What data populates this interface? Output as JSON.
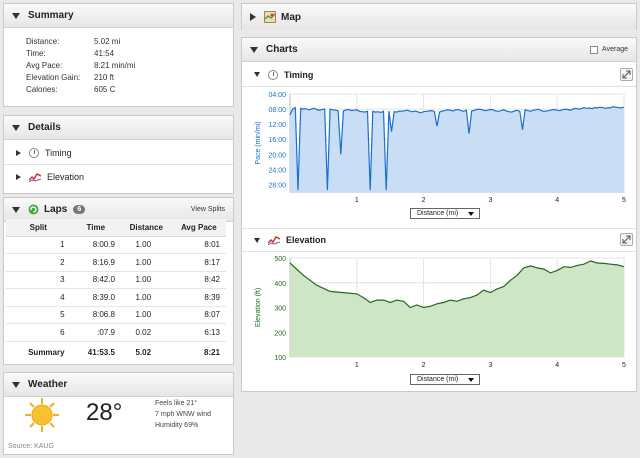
{
  "summary": {
    "title": "Summary",
    "rows": [
      {
        "label": "Distance:",
        "value": "5.02 mi"
      },
      {
        "label": "Time:",
        "value": "41:54"
      },
      {
        "label": "Avg Pace:",
        "value": "8:21 min/mi"
      },
      {
        "label": "Elevation Gain:",
        "value": "210 ft"
      },
      {
        "label": "Calories:",
        "value": "605 C"
      }
    ]
  },
  "details": {
    "title": "Details",
    "items": [
      {
        "label": "Timing",
        "icon": "clock-icon"
      },
      {
        "label": "Elevation",
        "icon": "elevation-icon"
      }
    ]
  },
  "laps": {
    "title": "Laps",
    "count": "6",
    "view_splits": "View Splits",
    "columns": [
      "Split",
      "Time",
      "Distance",
      "Avg Pace"
    ],
    "rows": [
      [
        "1",
        "8:00.9",
        "1.00",
        "8:01"
      ],
      [
        "2",
        "8:16.9",
        "1.00",
        "8:17"
      ],
      [
        "3",
        "8:42.0",
        "1.00",
        "8:42"
      ],
      [
        "4",
        "8:39.0",
        "1.00",
        "8:39"
      ],
      [
        "5",
        "8:06.8",
        "1.00",
        "8:07"
      ],
      [
        "6",
        ":07.9",
        "0.02",
        "6:13"
      ]
    ],
    "summary": [
      "Summary",
      "41:53.5",
      "5.02",
      "8:21"
    ]
  },
  "weather": {
    "title": "Weather",
    "temp": "28°",
    "feels_like": "Feels like 21°",
    "wind": "7 mph WNW wind",
    "humidity": "Humidity 69%",
    "source": "Source: KAUG",
    "icon": "sun-icon"
  },
  "map": {
    "title": "Map",
    "icon": "map-icon"
  },
  "charts": {
    "title": "Charts",
    "average_label": "Average",
    "average_checked": false,
    "timing": {
      "title": "Timing",
      "axis_select": "Distance (mi)"
    },
    "elevation": {
      "title": "Elevation",
      "axis_select": "Distance (mi)"
    }
  },
  "colors": {
    "pace": "#1a6fd0",
    "pace_fill": "#c9def5",
    "elev": "#1e6b1e",
    "elev_fill": "#cfe6c6"
  },
  "chart_data": [
    {
      "type": "area",
      "title": "",
      "xlabel": "Distance (mi)",
      "ylabel": "Pace (min/mi)",
      "xlim": [
        0,
        5
      ],
      "ylim": [
        4,
        30
      ],
      "y_inverted": true,
      "x_ticks": [
        "1",
        "2",
        "3",
        "4",
        "5"
      ],
      "y_ticks": [
        "04:00",
        "08:00",
        "12:00",
        "16:00",
        "20:00",
        "24:00",
        "28:00"
      ],
      "grid": true,
      "series": [
        {
          "x": [
            0.0,
            0.04,
            0.08,
            0.12,
            0.16,
            0.2,
            0.24,
            0.28,
            0.32,
            0.36,
            0.4,
            0.44,
            0.48,
            0.52,
            0.56,
            0.6,
            0.64,
            0.68,
            0.72,
            0.76,
            0.8,
            0.84,
            0.88,
            0.92,
            0.96,
            1.0,
            1.04,
            1.08,
            1.12,
            1.16,
            1.2,
            1.24,
            1.28,
            1.32,
            1.36,
            1.4,
            1.44,
            1.48,
            1.52,
            1.56,
            1.6,
            1.64,
            1.68,
            1.72,
            1.76,
            1.8,
            1.84,
            1.88,
            1.92,
            1.96,
            2.0,
            2.04,
            2.08,
            2.12,
            2.16,
            2.2,
            2.24,
            2.28,
            2.32,
            2.36,
            2.4,
            2.44,
            2.48,
            2.52,
            2.56,
            2.6,
            2.64,
            2.68,
            2.72,
            2.76,
            2.8,
            2.84,
            2.88,
            2.92,
            2.96,
            3.0,
            3.04,
            3.08,
            3.12,
            3.16,
            3.2,
            3.24,
            3.28,
            3.32,
            3.36,
            3.4,
            3.44,
            3.48,
            3.52,
            3.56,
            3.6,
            3.64,
            3.68,
            3.72,
            3.76,
            3.8,
            3.84,
            3.88,
            3.92,
            3.96,
            4.0,
            4.04,
            4.08,
            4.12,
            4.16,
            4.2,
            4.24,
            4.28,
            4.32,
            4.36,
            4.4,
            4.44,
            4.48,
            4.52,
            4.56,
            4.6,
            4.64,
            4.68,
            4.72,
            4.76,
            4.8,
            4.84,
            4.88,
            4.92,
            4.96,
            5.0
          ],
          "values": [
            9.5,
            8.0,
            7.6,
            29.5,
            7.8,
            8.0,
            7.9,
            8.2,
            8.0,
            7.8,
            8.1,
            8.3,
            8.1,
            8.0,
            29.5,
            8.0,
            8.2,
            8.3,
            8.4,
            20.0,
            8.5,
            8.2,
            8.1,
            8.4,
            8.3,
            8.2,
            8.6,
            8.7,
            8.8,
            8.6,
            29.5,
            8.6,
            8.8,
            8.7,
            8.9,
            8.6,
            29.5,
            8.5,
            14.0,
            8.7,
            8.8,
            8.5,
            8.6,
            8.4,
            8.3,
            8.6,
            8.7,
            8.5,
            8.8,
            9.0,
            8.7,
            8.6,
            8.5,
            8.4,
            8.6,
            12.5,
            8.8,
            8.5,
            8.4,
            8.2,
            8.3,
            8.5,
            8.2,
            8.1,
            8.4,
            8.6,
            8.3,
            14.5,
            8.5,
            8.3,
            8.1,
            8.0,
            8.2,
            8.4,
            8.3,
            8.1,
            8.2,
            8.5,
            8.6,
            8.4,
            8.2,
            8.5,
            8.7,
            8.8,
            8.5,
            8.3,
            8.6,
            13.5,
            8.2,
            8.4,
            8.6,
            8.3,
            8.2,
            8.0,
            8.4,
            8.6,
            8.5,
            8.4,
            8.2,
            8.1,
            8.3,
            8.4,
            8.2,
            8.0,
            8.1,
            8.3,
            8.0,
            7.8,
            8.0,
            7.9,
            7.6,
            7.8,
            7.7,
            7.9,
            7.6,
            7.7,
            7.5,
            7.6,
            7.8,
            7.7,
            7.6,
            7.4,
            7.5,
            7.6,
            7.7,
            7.5
          ]
        }
      ]
    },
    {
      "type": "area",
      "title": "",
      "xlabel": "Distance (mi)",
      "ylabel": "Elevation (ft)",
      "xlim": [
        0,
        5
      ],
      "ylim": [
        100,
        500
      ],
      "x_ticks": [
        "1",
        "2",
        "3",
        "4",
        "5"
      ],
      "y_ticks": [
        "100",
        "200",
        "300",
        "400",
        "500"
      ],
      "grid": true,
      "series": [
        {
          "x": [
            0.0,
            0.2,
            0.4,
            0.6,
            0.8,
            1.0,
            1.1,
            1.2,
            1.3,
            1.4,
            1.5,
            1.6,
            1.7,
            1.8,
            1.9,
            2.0,
            2.1,
            2.2,
            2.3,
            2.4,
            2.5,
            2.6,
            2.7,
            2.8,
            2.9,
            3.0,
            3.1,
            3.2,
            3.3,
            3.4,
            3.5,
            3.6,
            3.7,
            3.8,
            3.9,
            4.0,
            4.1,
            4.2,
            4.3,
            4.4,
            4.5,
            4.6,
            4.7,
            4.8,
            4.9,
            5.0
          ],
          "values": [
            480,
            430,
            390,
            365,
            360,
            355,
            340,
            320,
            330,
            330,
            320,
            330,
            325,
            300,
            310,
            300,
            305,
            315,
            320,
            330,
            325,
            335,
            340,
            350,
            370,
            360,
            375,
            385,
            410,
            430,
            460,
            468,
            460,
            455,
            440,
            450,
            465,
            462,
            470,
            475,
            488,
            480,
            478,
            475,
            472,
            465
          ]
        }
      ]
    }
  ]
}
